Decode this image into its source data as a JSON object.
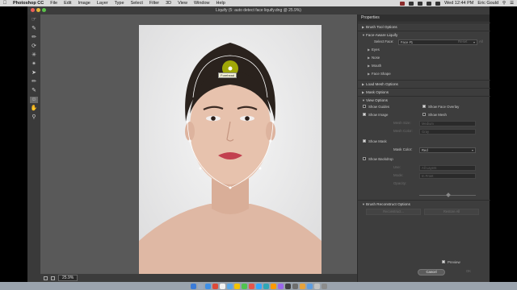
{
  "menubar": {
    "items": [
      {
        "label": "Photoshop CC",
        "name": "app-menu"
      },
      {
        "label": "File",
        "name": "menu-file"
      },
      {
        "label": "Edit",
        "name": "menu-edit"
      },
      {
        "label": "Image",
        "name": "menu-image"
      },
      {
        "label": "Layer",
        "name": "menu-layer"
      },
      {
        "label": "Type",
        "name": "menu-type"
      },
      {
        "label": "Select",
        "name": "menu-select"
      },
      {
        "label": "Filter",
        "name": "menu-filter"
      },
      {
        "label": "3D",
        "name": "menu-3d"
      },
      {
        "label": "View",
        "name": "menu-view"
      },
      {
        "label": "Window",
        "name": "menu-window"
      },
      {
        "label": "Help",
        "name": "menu-help"
      }
    ],
    "clock": "Wed 12:44 PM",
    "user": "Eric Gould"
  },
  "window": {
    "title": "Liquify (5: auto detect face liquify.dng @ 25.9%)"
  },
  "canvas": {
    "pin_tooltip": "Forehead"
  },
  "statusbar": {
    "zoom": "25.9%"
  },
  "panel": {
    "title": "Properties",
    "sections": {
      "brush_tool_options": "Brush Tool Options",
      "face_aware_liquify": "Face-Aware Liquify",
      "load_mesh_options": "Load Mesh Options",
      "mask_options": "Mask Options",
      "view_options": "View Options",
      "brush_reconstruct_options": "Brush Reconstruct Options"
    },
    "select_face_label": "Select Face:",
    "select_face_value": "Face #1",
    "reset_label": "Reset",
    "all_label": "All",
    "face_subsections": [
      "Eyes",
      "Nose",
      "Mouth",
      "Face Shape"
    ],
    "show_guides": "Show Guides",
    "show_face_overlay": "Show Face Overlay",
    "show_image": "Show Image",
    "show_mesh": "Show Mesh",
    "mesh_size_label": "Mesh Size:",
    "mesh_size_value": "Medium",
    "mesh_color_label": "Mesh Color:",
    "mesh_color_value": "Gray",
    "show_mask": "Show Mask",
    "mask_color_label": "Mask Color:",
    "mask_color_value": "Red",
    "show_backdrop": "Show Backdrop",
    "use_label": "Use:",
    "use_value": "All Layers",
    "mode_label": "Mode:",
    "mode_value": "In Front",
    "opacity_label": "Opacity:",
    "reconstruct_label": "Reconstruct...",
    "restore_all_label": "Restore All",
    "preview_label": "Preview",
    "cancel_label": "Cancel",
    "ok_label": "OK",
    "checks": {
      "show_guides": false,
      "show_face_overlay": true,
      "show_image": true,
      "show_mesh": false,
      "show_mask": true,
      "show_backdrop": false,
      "preview": true
    }
  },
  "colors": {
    "pin": "#c8d400",
    "lips": "#c2404f",
    "hair": "#2a221d"
  }
}
